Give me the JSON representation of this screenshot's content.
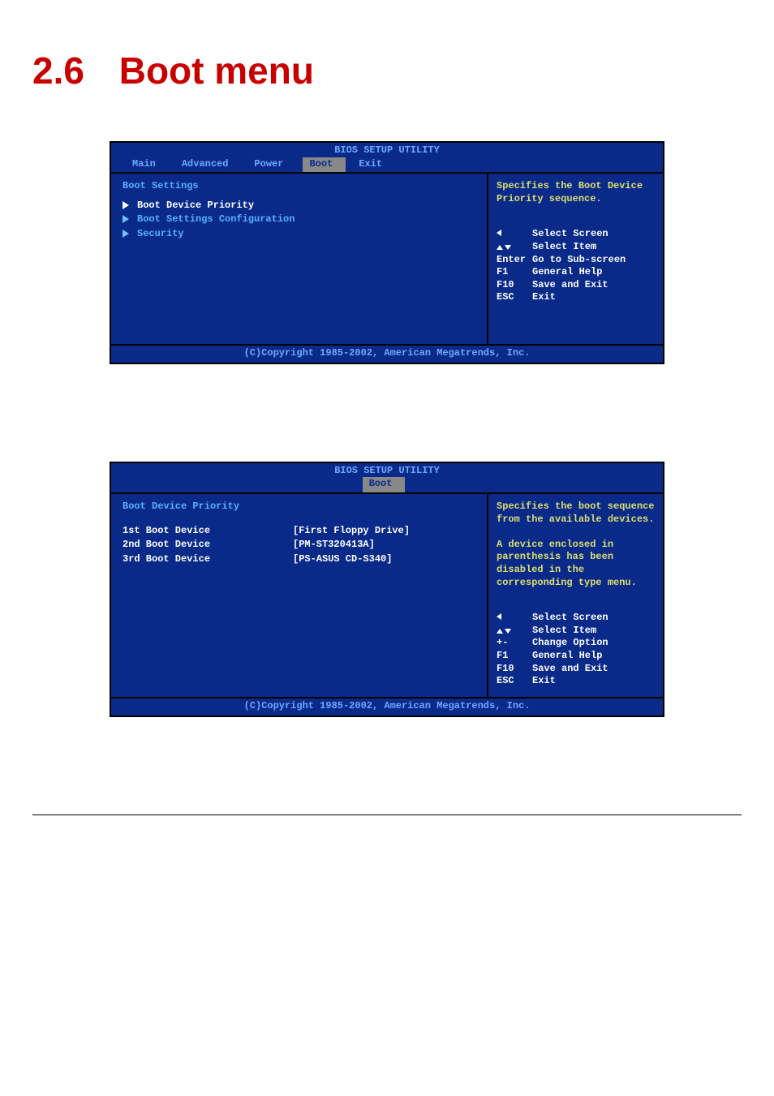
{
  "page": {
    "section_number": "2.6",
    "section_title": "Boot menu"
  },
  "bios_common": {
    "title_text": "BIOS SETUP UTILITY",
    "footer_text": "(C)Copyright 1985-2002, American Megatrends, Inc."
  },
  "bios1": {
    "tabs": [
      "Main",
      "Advanced",
      "Power",
      "Boot",
      "Exit"
    ],
    "active_tab_index": 3,
    "heading": "Boot Settings",
    "submenus": [
      {
        "label": "Boot Device Priority",
        "selected": true
      },
      {
        "label": "Boot Settings Configuration",
        "selected": false
      },
      {
        "label": "Security",
        "selected": false
      }
    ],
    "help_text": "Specifies the Boot Device Priority sequence.",
    "legend": [
      {
        "key_type": "lr",
        "key": "",
        "desc": "Select Screen"
      },
      {
        "key_type": "ud",
        "key": "",
        "desc": "Select Item"
      },
      {
        "key_type": "txt",
        "key": "Enter",
        "desc": "Go to Sub-screen"
      },
      {
        "key_type": "txt",
        "key": "F1",
        "desc": "General Help"
      },
      {
        "key_type": "txt",
        "key": "F10",
        "desc": "Save and Exit"
      },
      {
        "key_type": "txt",
        "key": "ESC",
        "desc": "Exit"
      }
    ]
  },
  "bios2": {
    "tab_label": "Boot",
    "heading": "Boot Device Priority",
    "items": [
      {
        "label": "1st Boot Device",
        "value": "[First Floppy Drive]",
        "selected": true
      },
      {
        "label": "2nd Boot Device",
        "value": "[PM-ST320413A]",
        "selected": false
      },
      {
        "label": "3rd Boot Device",
        "value": "[PS-ASUS CD-S340]",
        "selected": false
      }
    ],
    "help_text": "Specifies the boot sequence from the available devices.\n\nA device enclosed in parenthesis has been disabled in the corresponding type menu.",
    "legend": [
      {
        "key_type": "lr",
        "key": "",
        "desc": "Select Screen"
      },
      {
        "key_type": "ud",
        "key": "",
        "desc": "Select Item"
      },
      {
        "key_type": "txt",
        "key": "+-",
        "desc": "Change Option"
      },
      {
        "key_type": "txt",
        "key": "F1",
        "desc": "General Help"
      },
      {
        "key_type": "txt",
        "key": "F10",
        "desc": "Save and Exit"
      },
      {
        "key_type": "txt",
        "key": "ESC",
        "desc": "Exit"
      }
    ]
  }
}
